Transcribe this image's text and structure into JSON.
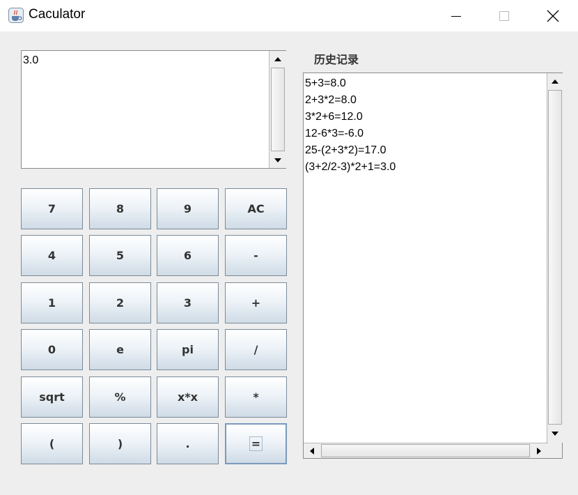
{
  "window": {
    "title": "Caculator",
    "icon": "java-cup-icon",
    "controls": [
      "minimize-icon",
      "maximize-icon",
      "close-icon"
    ]
  },
  "display": {
    "value": "3.0"
  },
  "keypad": {
    "rows": [
      [
        "7",
        "8",
        "9",
        "AC"
      ],
      [
        "4",
        "5",
        "6",
        "-"
      ],
      [
        "1",
        "2",
        "3",
        "+"
      ],
      [
        "0",
        "e",
        "pi",
        "/"
      ],
      [
        "sqrt",
        "%",
        "x*x",
        "*"
      ],
      [
        "(",
        ")",
        ".",
        "="
      ]
    ]
  },
  "history": {
    "label": "历史记录",
    "entries": [
      "5+3=8.0",
      "2+3*2=8.0",
      "3*2+6=12.0",
      "12-6*3=-6.0",
      "25-(2+3*2)=17.0",
      "(3+2/2-3)*2+1=3.0"
    ]
  }
}
